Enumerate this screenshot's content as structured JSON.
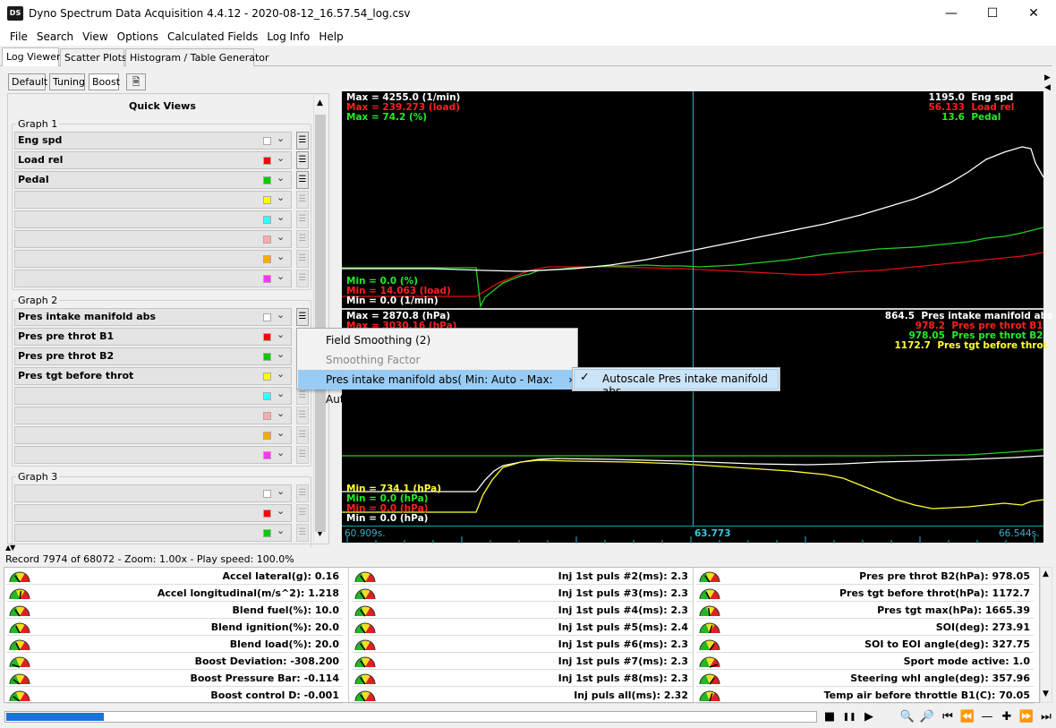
{
  "window": {
    "title": "Dyno Spectrum Data Acquisition 4.4.12 - 2020-08-12_16.57.54_log.csv",
    "icon_label": "DS"
  },
  "menu": [
    "File",
    "Search",
    "View",
    "Options",
    "Calculated Fields",
    "Log Info",
    "Help"
  ],
  "main_tabs": [
    "Log Viewer",
    "Scatter Plots",
    "Histogram / Table Generator"
  ],
  "sub_tabs": [
    "Default",
    "Tuning",
    "Boost"
  ],
  "quick_views": {
    "title": "Quick Views",
    "graph1": {
      "label": "Graph 1",
      "rows": [
        {
          "name": "Eng spd",
          "color": "#ffffff",
          "btn": true
        },
        {
          "name": "Load rel",
          "color": "#ff0000",
          "btn": true
        },
        {
          "name": "Pedal",
          "color": "#00cc00",
          "btn": true
        },
        {
          "name": "",
          "color": "#ffff00",
          "btn": false
        },
        {
          "name": "",
          "color": "#33ffff",
          "btn": false
        },
        {
          "name": "",
          "color": "#ffaaaa",
          "btn": false
        },
        {
          "name": "",
          "color": "#ffaa00",
          "btn": false
        },
        {
          "name": "",
          "color": "#ff33ff",
          "btn": false
        }
      ]
    },
    "graph2": {
      "label": "Graph 2",
      "rows": [
        {
          "name": "Pres intake manifold abs",
          "color": "#ffffff",
          "btn": true
        },
        {
          "name": "Pres pre throt B1",
          "color": "#ff0000",
          "btn": false
        },
        {
          "name": "Pres pre throt B2",
          "color": "#00cc00",
          "btn": false
        },
        {
          "name": "Pres tgt before throt",
          "color": "#ffff00",
          "btn": false
        },
        {
          "name": "",
          "color": "#33ffff",
          "btn": false
        },
        {
          "name": "",
          "color": "#ffaaaa",
          "btn": false
        },
        {
          "name": "",
          "color": "#ffaa00",
          "btn": false
        },
        {
          "name": "",
          "color": "#ff33ff",
          "btn": false
        }
      ]
    },
    "graph3": {
      "label": "Graph 3",
      "rows": [
        {
          "name": "",
          "color": "#ffffff",
          "btn": false
        },
        {
          "name": "",
          "color": "#ff0000",
          "btn": false
        },
        {
          "name": "",
          "color": "#00cc00",
          "btn": false
        }
      ]
    }
  },
  "chart_top": {
    "max_labels": [
      {
        "text": "Max = 4255.0 (1/min)",
        "color": "#ffffff"
      },
      {
        "text": "Max = 239.273 (load)",
        "color": "#ff2020"
      },
      {
        "text": "Max = 74.2 (%)",
        "color": "#22ee22"
      }
    ],
    "min_labels": [
      {
        "text": "Min = 0.0 (%)",
        "color": "#22ee22"
      },
      {
        "text": "Min = 14.063 (load)",
        "color": "#ff2020"
      },
      {
        "text": "Min = 0.0 (1/min)",
        "color": "#ffffff"
      }
    ],
    "values": [
      {
        "value": "1195.0",
        "name": "Eng spd",
        "color": "#ffffff"
      },
      {
        "value": "56.133",
        "name": "Load rel",
        "color": "#ff2020"
      },
      {
        "value": "13.6",
        "name": "Pedal",
        "color": "#22ee22"
      }
    ]
  },
  "chart_bottom": {
    "max_labels": [
      {
        "text": "Max = 2870.8 (hPa)",
        "color": "#ffffff"
      },
      {
        "text": "Max = 3030.16 (hPa)",
        "color": "#ff2020"
      }
    ],
    "min_labels": [
      {
        "text": "Min = 734.1 (hPa)",
        "color": "#ffff33"
      },
      {
        "text": "Min = 0.0 (hPa)",
        "color": "#22ee22"
      },
      {
        "text": "Min = 0.0 (hPa)",
        "color": "#ff2020"
      },
      {
        "text": "Min = 0.0 (hPa)",
        "color": "#ffffff"
      }
    ],
    "values": [
      {
        "value": "864.5",
        "name": "Pres intake manifold abs",
        "color": "#ffffff"
      },
      {
        "value": "978.2",
        "name": "Pres pre throt B1",
        "color": "#ff2020"
      },
      {
        "value": "978.05",
        "name": "Pres pre throt B2",
        "color": "#22ee22"
      },
      {
        "value": "1172.7",
        "name": "Pres tgt before throt",
        "color": "#ffff33"
      }
    ]
  },
  "timebar": {
    "start": "60.909s.",
    "cursor": "63.773",
    "end": "66.544s."
  },
  "context_menu": {
    "items": [
      "Field Smoothing (2)",
      "Smoothing Factor",
      "Pres intake manifold abs( Min: Auto - Max: Auto )"
    ],
    "submenu": "Autoscale Pres intake manifold abs",
    "check": "✓",
    "arrow": "›"
  },
  "status": "Record 7974 of 68072 - Zoom: 1.00x - Play speed: 100.0%",
  "gauges": {
    "col1": [
      {
        "label": "Accel lateral(g): 0.16",
        "level": 0.3
      },
      {
        "label": "Accel longitudinal(m/s^2): 1.218",
        "level": 0.55
      },
      {
        "label": "Blend fuel(%): 10.0",
        "level": 0.3
      },
      {
        "label": "Blend ignition(%): 20.0",
        "level": 0.35
      },
      {
        "label": "Blend load(%): 20.0",
        "level": 0.35
      },
      {
        "label": "Boost Deviation: -308.200",
        "level": 0.1
      },
      {
        "label": "Boost Pressure Bar: -0.114",
        "level": 0.2
      },
      {
        "label": "Boost control D: -0.001",
        "level": 0.2
      }
    ],
    "col2": [
      {
        "label": "Inj 1st puls #2(ms): 2.3",
        "level": 0.3
      },
      {
        "label": "Inj 1st puls #3(ms): 2.3",
        "level": 0.3
      },
      {
        "label": "Inj 1st puls #4(ms): 2.3",
        "level": 0.3
      },
      {
        "label": "Inj 1st puls #5(ms): 2.4",
        "level": 0.3
      },
      {
        "label": "Inj 1st puls #6(ms): 2.3",
        "level": 0.3
      },
      {
        "label": "Inj 1st puls #7(ms): 2.3",
        "level": 0.3
      },
      {
        "label": "Inj 1st puls #8(ms): 2.3",
        "level": 0.3
      },
      {
        "label": "Inj puls all(ms): 2.32",
        "level": 0.3
      }
    ],
    "col3": [
      {
        "label": "Pres pre throt B2(hPa): 978.05",
        "level": 0.3
      },
      {
        "label": "Pres tgt before throt(hPa): 1172.7",
        "level": 0.35
      },
      {
        "label": "Pres tgt max(hPa): 1665.39",
        "level": 0.45
      },
      {
        "label": "SOI(deg): 273.91",
        "level": 0.6
      },
      {
        "label": "SOI to EOI angle(deg): 327.75",
        "level": 0.7
      },
      {
        "label": "Sport mode active: 1.0",
        "level": 0.9
      },
      {
        "label": "Steering whl angle(deg): 357.96",
        "level": 0.7
      },
      {
        "label": "Temp air before throttle B1(C): 70.05",
        "level": 0.6
      }
    ]
  },
  "progress": 0.12,
  "playback_icons": [
    "stop-icon",
    "pause-icon",
    "play-icon",
    "zoom-out-icon",
    "zoom-in-icon",
    "skip-start-icon",
    "rewind-icon",
    "minus-icon",
    "plus-icon",
    "fast-forward-icon",
    "skip-end-icon"
  ]
}
